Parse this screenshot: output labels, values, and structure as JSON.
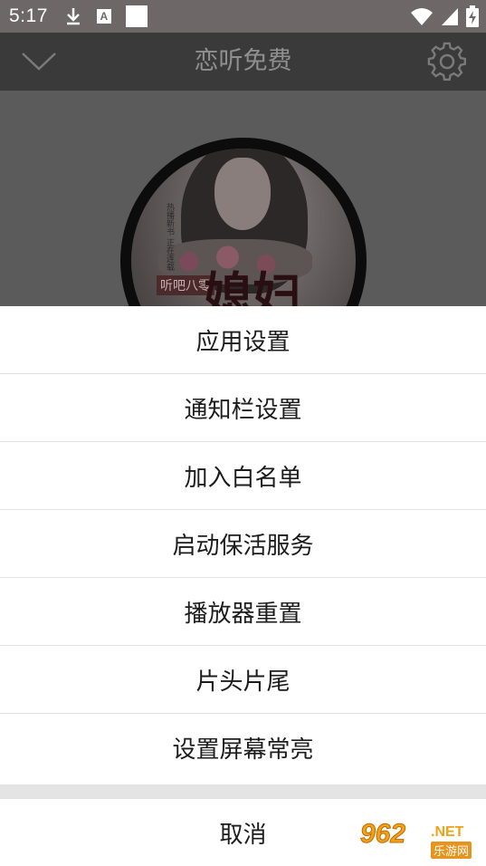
{
  "status_bar": {
    "time": "5:17",
    "icons": [
      "download-icon",
      "a-badge-icon",
      "notification-square-icon",
      "wifi-icon",
      "signal-icon",
      "battery-charging-icon"
    ],
    "a_badge": "A"
  },
  "toolbar": {
    "title": "恋听免费"
  },
  "cover": {
    "title": "媳妇",
    "series": "听吧八零",
    "side_text": "热播新书 正在连载"
  },
  "menu": {
    "items": [
      {
        "label": "应用设置"
      },
      {
        "label": "通知栏设置"
      },
      {
        "label": "加入白名单"
      },
      {
        "label": "启动保活服务"
      },
      {
        "label": "播放器重置"
      },
      {
        "label": "片头片尾"
      },
      {
        "label": "设置屏幕常亮"
      }
    ],
    "cancel_label": "取消"
  },
  "watermark": {
    "number": "962",
    "suffix": ".NET",
    "site": "乐游网"
  },
  "colors": {
    "status_bar": "#6e6767",
    "toolbar": "#3a3a3a",
    "sheet": "#ffffff",
    "separator": "#e4e4e4",
    "watermark": "#f0a21a"
  }
}
